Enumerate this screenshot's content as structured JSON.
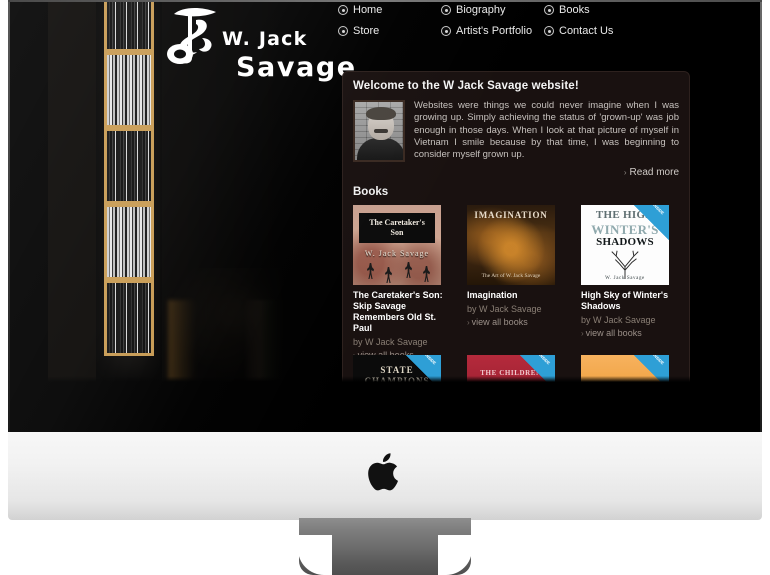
{
  "device": {
    "name": "iMac",
    "logo_icon": "apple-logo"
  },
  "site": {
    "logo": {
      "mark_icon": "wjs-monogram-icon",
      "line1": "W. Jack",
      "line2": "Savage"
    },
    "nav": {
      "bullet_icon": "radio-bullet-icon",
      "items": [
        {
          "label": "Home"
        },
        {
          "label": "Biography"
        },
        {
          "label": "Books"
        },
        {
          "label": "Store"
        },
        {
          "label": "Artist's Portfolio"
        },
        {
          "label": "Contact Us"
        }
      ]
    },
    "welcome": {
      "title": "Welcome to the W Jack Savage website!",
      "portrait_alt": "portrait-photo",
      "body": "Websites were things we could never imagine when I was growing up. Simply achieving the status of 'grown-up' was job enough in those days. When I look at that picture of myself in Vietnam I smile because by that time, I was beginning to consider myself grown up.",
      "read_more": "Read more",
      "caret": "›"
    },
    "books_section": {
      "heading": "Books",
      "caret": "›",
      "items": [
        {
          "title": "The Caretaker's Son: Skip Savage Remembers Old St. Paul",
          "author": "by W Jack Savage",
          "view_all": "view all books",
          "cover": {
            "band_line1": "The Caretaker's",
            "band_line2": "Son",
            "author_line": "W.  Jack  Savage"
          }
        },
        {
          "title": "Imagination",
          "author": "by W Jack Savage",
          "view_all": "view all books",
          "cover": {
            "title_line": "IMAGINATION",
            "subtitle_line": "The Art of W. Jack Savage"
          }
        },
        {
          "title": "High Sky of Winter's Shadows",
          "author": "by W Jack Savage",
          "view_all": "view all books",
          "cover": {
            "title_line1": "THE HIGH",
            "title_line2": "WINTER'S",
            "title_line3": "SHADOWS",
            "author_line": "W. Jack Savage",
            "ribbon": "LOOK INSIDE"
          }
        }
      ],
      "items_row2": [
        {
          "cover": {
            "title_line": "STATE CHAMPIONS",
            "ribbon": "LOOK INSIDE"
          }
        },
        {
          "cover": {
            "title_line": "THE CHILDREN",
            "ribbon": "LOOK INSIDE"
          }
        },
        {
          "cover": {
            "title_line": "",
            "ribbon": "LOOK INSIDE"
          }
        }
      ]
    },
    "background": {
      "bookcase_alt": "bookcase-photo",
      "desk_alt": "desk-photo"
    }
  },
  "colors": {
    "page_background": "#ffffff",
    "bezel": "#000000",
    "chin": "#f2f2f2",
    "site_background": "#0a0806",
    "panel_background": "#191110",
    "text_primary": "#f4f4f4",
    "text_body": "#c6c1bd",
    "text_muted": "#8a7f75",
    "ribbon_blue": "#2e9fd6",
    "shelf_wood": "#c79a52"
  }
}
